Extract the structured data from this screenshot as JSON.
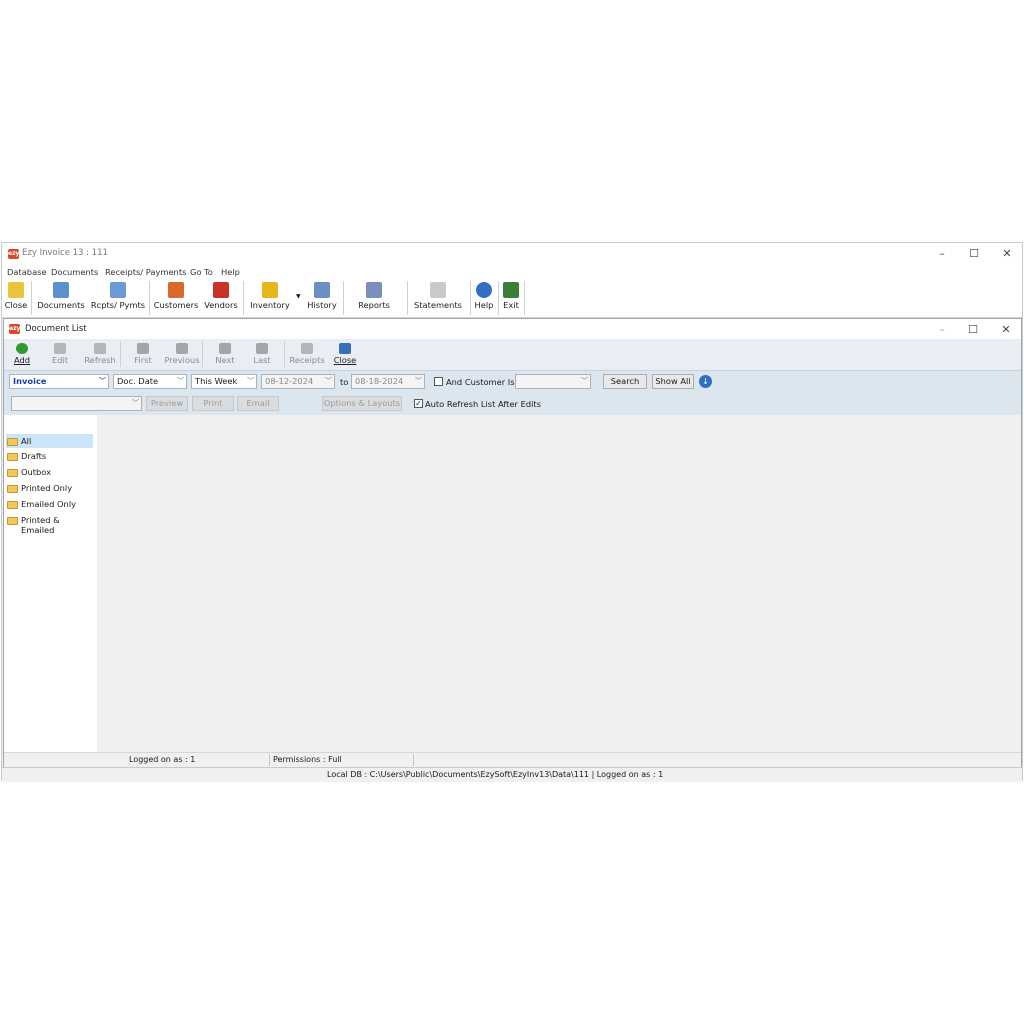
{
  "window": {
    "title": "Ezy Invoice 13 : 111",
    "logo": "ezy"
  },
  "menu": [
    "Database",
    "Documents",
    "Receipts/ Payments",
    "Go To",
    "Help"
  ],
  "toolbar": [
    {
      "label": "Close",
      "icon": "close-doc-icon",
      "color": "#e8c53a"
    },
    {
      "label": "Documents",
      "icon": "documents-icon",
      "color": "#5b8fcf"
    },
    {
      "label": "Rcpts/ Pymts",
      "icon": "receipts-pen-icon",
      "color": "#6a9bd8"
    },
    {
      "label": "Customers",
      "icon": "customers-icon",
      "color": "#d86b2a"
    },
    {
      "label": "Vendors",
      "icon": "vendors-truck-icon",
      "color": "#c8322a"
    },
    {
      "label": "Inventory",
      "icon": "inventory-coins-icon",
      "color": "#e6b520"
    },
    {
      "label": "History",
      "icon": "history-icon",
      "color": "#6a8fc0"
    },
    {
      "label": "Reports",
      "icon": "reports-icon",
      "color": "#7b8fbf"
    },
    {
      "label": "Statements",
      "icon": "statements-envelope-icon",
      "color": "#8a8a8a"
    },
    {
      "label": "Help",
      "icon": "help-icon",
      "color": "#2f6fc4"
    },
    {
      "label": "Exit",
      "icon": "exit-door-icon",
      "color": "#3b7d3a"
    }
  ],
  "doc_list": {
    "title": "Document List",
    "actions": [
      {
        "label": "Add",
        "icon": "add-icon",
        "enabled": true,
        "color": "#2f9a2f"
      },
      {
        "label": "Edit",
        "icon": "edit-icon",
        "enabled": false,
        "color": "#9a9a9a"
      },
      {
        "label": "Refresh",
        "icon": "refresh-icon",
        "enabled": false,
        "color": "#9a9a9a"
      },
      {
        "label": "First",
        "icon": "first-icon",
        "enabled": false,
        "color": "#8a8a8a"
      },
      {
        "label": "Previous",
        "icon": "previous-icon",
        "enabled": false,
        "color": "#8a8a8a"
      },
      {
        "label": "Next",
        "icon": "next-icon",
        "enabled": false,
        "color": "#8a8a8a"
      },
      {
        "label": "Last",
        "icon": "last-icon",
        "enabled": false,
        "color": "#8a8a8a"
      },
      {
        "label": "Receipts",
        "icon": "receipts-icon",
        "enabled": false,
        "color": "#9a9a9a"
      },
      {
        "label": "Close",
        "icon": "close-door-icon",
        "enabled": true,
        "color": "#3a6fb8"
      }
    ],
    "filter": {
      "doc_type": "Invoice",
      "date_field": "Doc. Date",
      "period": "This Week",
      "from_date": "08-12-2024",
      "to_label": "to",
      "to_date": "08-18-2024",
      "customer_check_label": "And Customer Is",
      "customer_value": "",
      "search_label": "Search",
      "show_all_label": "Show All"
    },
    "options": {
      "layout_select": "",
      "preview_label": "Preview",
      "print_label": "Print",
      "email_label": "Email",
      "options_label": "Options & Layouts",
      "auto_refresh_label": "Auto Refresh List After Edits",
      "auto_refresh_checked": true
    },
    "folders": [
      "All",
      "Drafts",
      "Outbox",
      "Printed Only",
      "Emailed Only",
      "Printed & Emailed"
    ],
    "selected_folder": "All",
    "status": {
      "logged_on": "Logged on as : 1",
      "permissions": "Permissions : Full"
    }
  },
  "main_status": "Local DB : C:\\Users\\Public\\Documents\\EzySoft\\EzyInv13\\Data\\111 | Logged on as : 1"
}
